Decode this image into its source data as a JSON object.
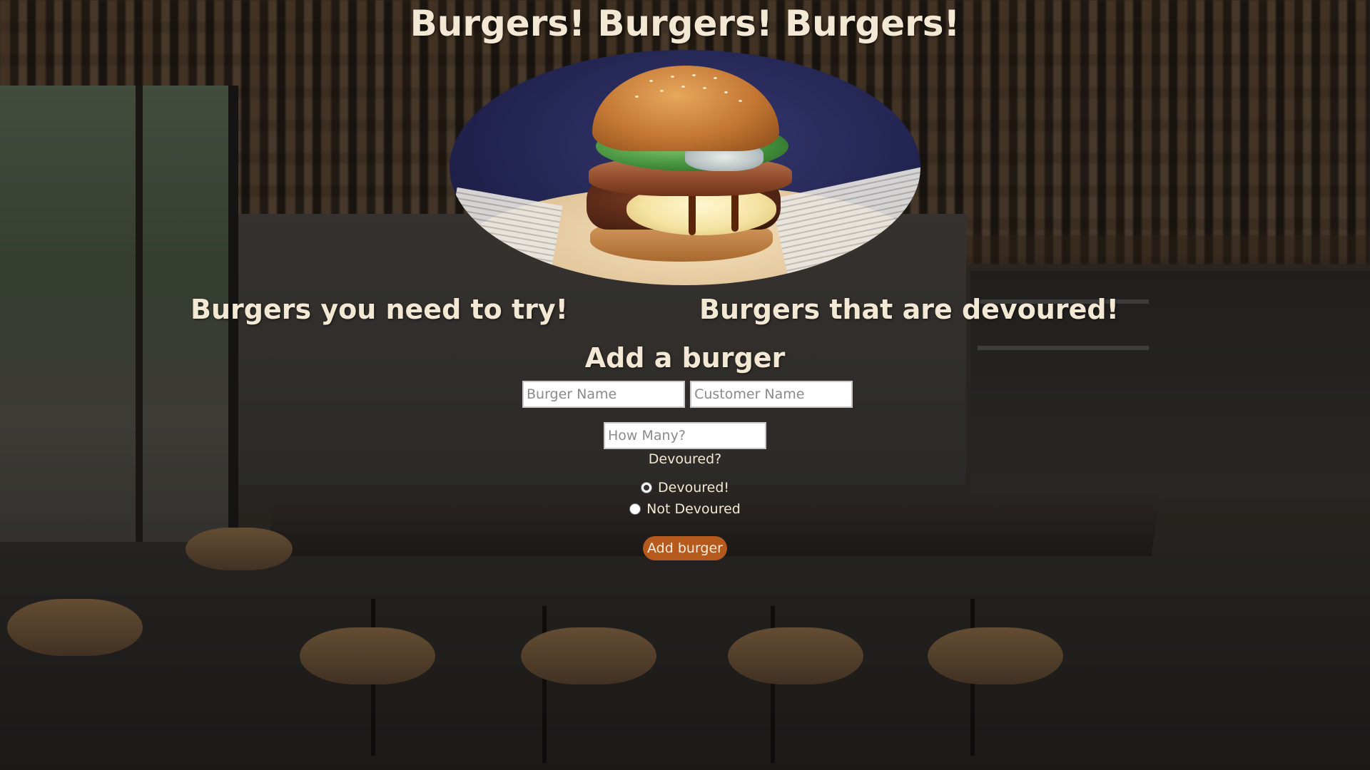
{
  "page": {
    "title": "Burgers! Burgers! Burgers!"
  },
  "hero_image": {
    "icon": "burger-photo"
  },
  "sections": {
    "to_try_heading": "Burgers you need to try!",
    "devoured_heading": "Burgers that are devoured!"
  },
  "form": {
    "title": "Add a burger",
    "burger_name": {
      "placeholder": "Burger Name",
      "value": ""
    },
    "customer_name": {
      "placeholder": "Customer Name",
      "value": ""
    },
    "how_many": {
      "placeholder": "How Many?",
      "value": ""
    },
    "devoured_question": "Devoured?",
    "options": [
      {
        "label": "Devoured!",
        "checked": true
      },
      {
        "label": "Not Devoured",
        "checked": false
      }
    ],
    "submit_label": "Add burger"
  },
  "colors": {
    "text": "#f3e8d4",
    "button": "#b55a1c",
    "button_text": "#f6ecdc"
  }
}
